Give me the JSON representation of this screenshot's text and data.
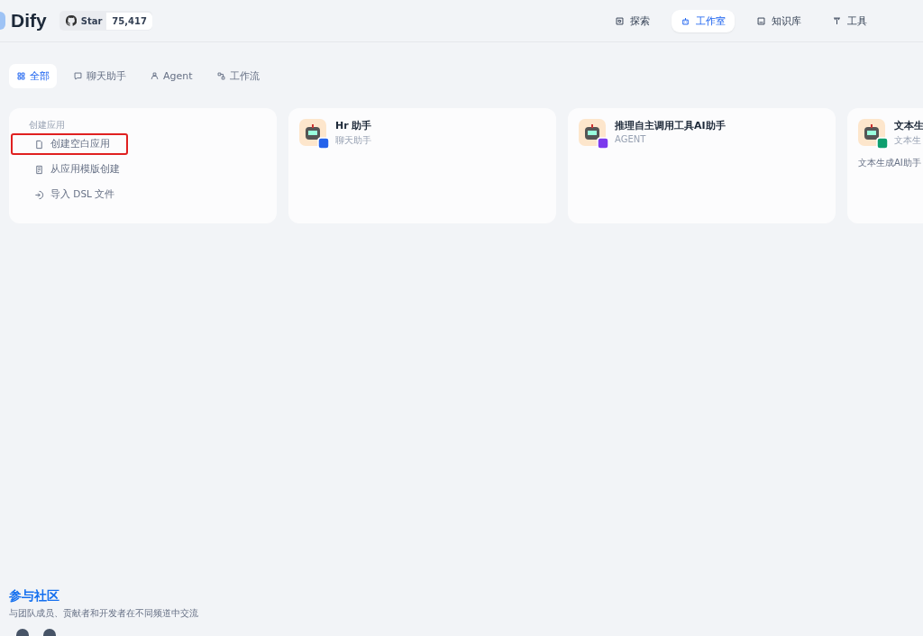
{
  "header": {
    "logo": "Dify",
    "github": {
      "label": "Star",
      "count": "75,417"
    },
    "nav": [
      {
        "label": "探索",
        "selected": false
      },
      {
        "label": "工作室",
        "selected": true
      },
      {
        "label": "知识库",
        "selected": false
      },
      {
        "label": "工具",
        "selected": false
      }
    ]
  },
  "filters": [
    {
      "label": "全部",
      "selected": true
    },
    {
      "label": "聊天助手",
      "selected": false
    },
    {
      "label": "Agent",
      "selected": false
    },
    {
      "label": "工作流",
      "selected": false
    }
  ],
  "create_card": {
    "title": "创建应用",
    "items": [
      {
        "label": "创建空白应用",
        "highlighted": true
      },
      {
        "label": "从应用模版创建",
        "highlighted": false
      },
      {
        "label": "导入 DSL 文件",
        "highlighted": false
      }
    ]
  },
  "apps": [
    {
      "name": "Hr 助手",
      "type": "聊天助手",
      "kind": "chat"
    },
    {
      "name": "推理自主调用工具AI助手",
      "type": "AGENT",
      "kind": "agent"
    },
    {
      "name": "文本生",
      "type": "文本生",
      "kind": "completion",
      "description": "文本生成AI助手"
    }
  ],
  "community": {
    "title": "参与社区",
    "text": "与团队成员、贡献者和开发者在不同频道中交流"
  }
}
